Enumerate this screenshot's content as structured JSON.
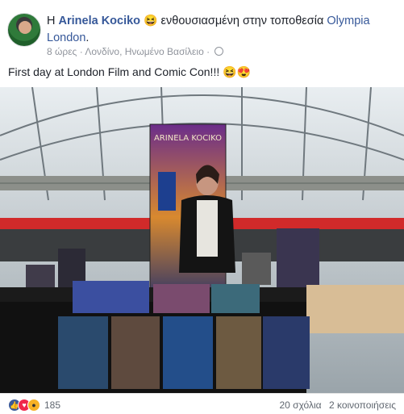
{
  "post": {
    "author_prefix": "Η",
    "author": "Arinela Kociko",
    "feeling_emoji": "😆",
    "feeling_text": "ενθουσιασμένη στην τοποθεσία",
    "location": "Olympia London",
    "location_suffix": ".",
    "time": "8 ώρες",
    "separator": "·",
    "place": "Λονδίνο, Ηνωμένο Βασίλειο",
    "text": "First day at London Film and Comic Con!!!",
    "text_emojis": "😆😍"
  },
  "photo": {
    "banner_text": "ARINELA KOCIKO"
  },
  "footer": {
    "reaction_icons": [
      "like-icon",
      "love-icon",
      "wow-icon"
    ],
    "reaction_count": "185",
    "comments": "20 σχόλια",
    "shares": "2 κοινοποιήσεις"
  },
  "colors": {
    "link": "#365899",
    "meta": "#90949c",
    "like": "#3b5998",
    "love": "#f0284a",
    "wow": "#f7b125"
  }
}
